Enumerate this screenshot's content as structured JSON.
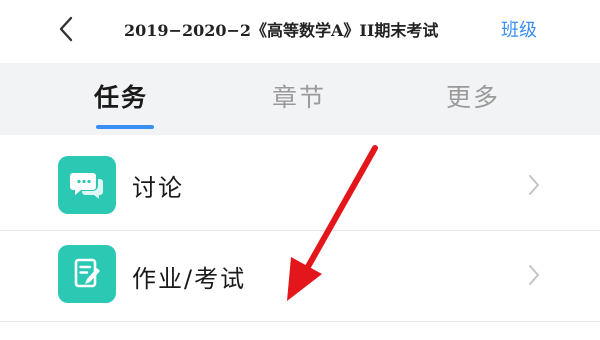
{
  "header": {
    "title": "2019−2020−2《高等数学A》II期末考试",
    "class_link": "班级",
    "back_icon": "chevron-left-icon"
  },
  "tabs": [
    {
      "label": "任务",
      "active": true
    },
    {
      "label": "章节",
      "active": false
    },
    {
      "label": "更多",
      "active": false
    }
  ],
  "list": {
    "items": [
      {
        "label": "讨论",
        "icon": "chat-bubbles-icon",
        "icon_color": "#2bc8b4"
      },
      {
        "label": "作业/考试",
        "icon": "edit-document-icon",
        "icon_color": "#2bc8b4"
      }
    ]
  },
  "colors": {
    "accent": "#3a8ef6",
    "icon_teal": "#2bc8b4",
    "annotation_arrow": "#e3161c"
  }
}
